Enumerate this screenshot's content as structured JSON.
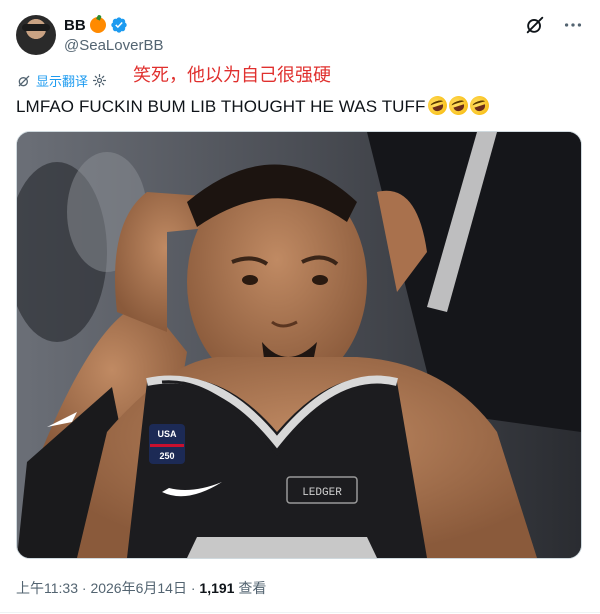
{
  "author": {
    "display_name": "BB",
    "handle": "@SeaLoverBB"
  },
  "translate": {
    "label": "显示翻译"
  },
  "overlay_caption": "笑死，他以为自己很强硬",
  "tweet": {
    "text": "LMFAO FUCKIN BUM LIB THOUGHT HE WAS TUFF"
  },
  "media": {
    "jersey_text": "LEDGER",
    "patch_text_1": "USA",
    "patch_text_2": "250"
  },
  "meta": {
    "time": "上午11:33",
    "separator": " · ",
    "date": "2026年6月14日",
    "views_count": "1,191",
    "views_label": " 查看"
  },
  "colors": {
    "link": "#1d9bf0",
    "secondary_text": "#536471",
    "overlay_red": "#e0302e"
  }
}
